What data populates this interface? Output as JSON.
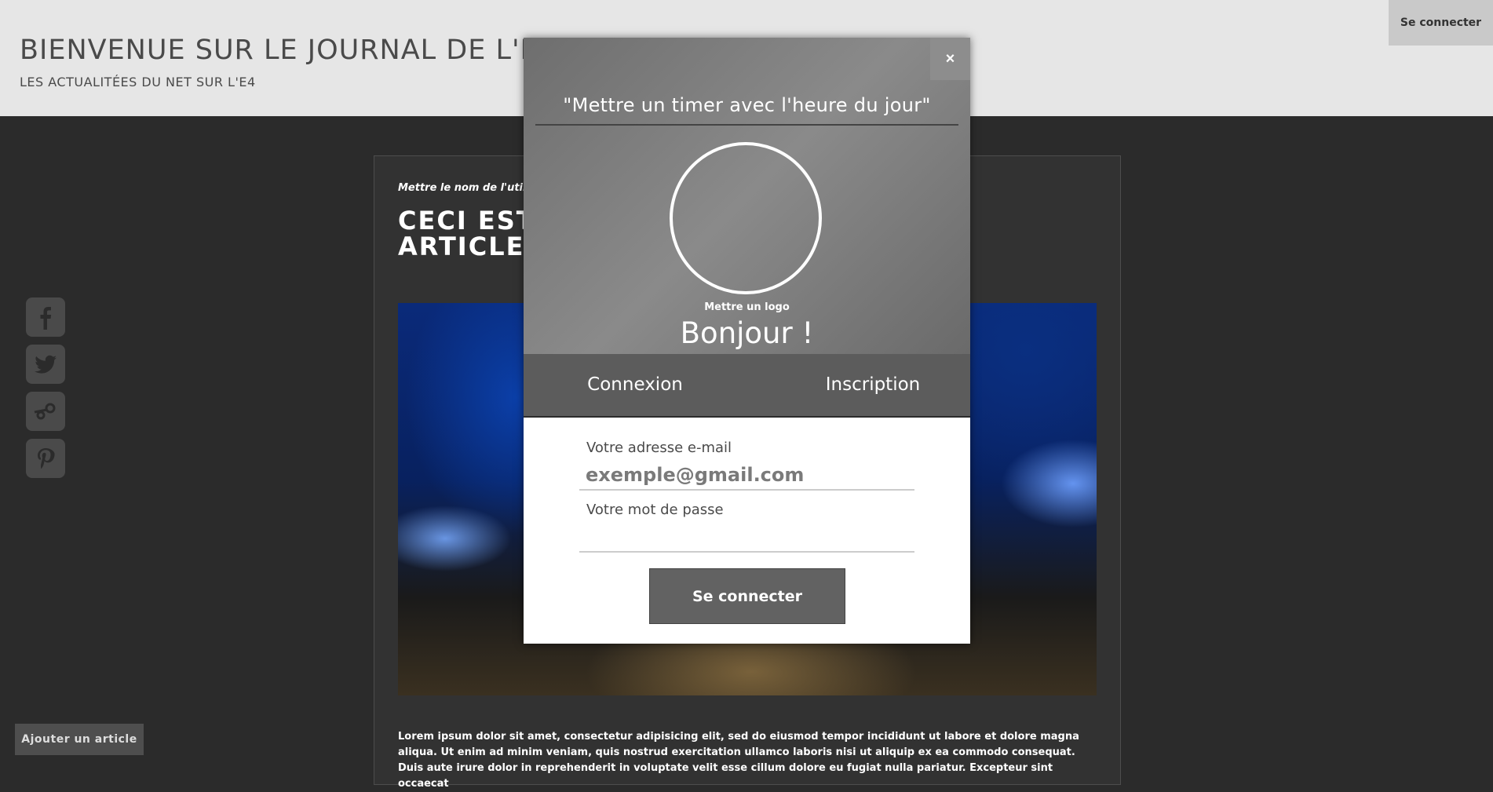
{
  "header": {
    "title": "BIENVENUE SUR LE JOURNAL DE L'E",
    "subtitle": "LES ACTUALITÉES DU NET SUR L'E4",
    "login_label": "Se connecter"
  },
  "article": {
    "author": "Mettre le nom de l'util",
    "title": "CECI EST ARTICLE",
    "body": "Lorem ipsum dolor sit amet, consectetur adipisicing elit, sed do eiusmod tempor incididunt ut labore et dolore magna aliqua. Ut enim ad minim veniam, quis nostrud exercitation ullamco laboris nisi ut aliquip ex ea commodo consequat. Duis aute irure dolor in reprehenderit in voluptate velit esse cillum dolore eu fugiat nulla pariatur. Excepteur sint occaecat"
  },
  "social": [
    {
      "icon": "facebook-icon"
    },
    {
      "icon": "twitter-icon"
    },
    {
      "icon": "steam-icon"
    },
    {
      "icon": "pinterest-icon"
    }
  ],
  "add_article_label": "Ajouter un article",
  "modal": {
    "close_label": "×",
    "timer_text": "\"Mettre un timer avec l'heure du jour\"",
    "logo_label": "Mettre un logo",
    "greeting": "Bonjour !",
    "tabs": [
      {
        "label": "Connexion"
      },
      {
        "label": "Inscription"
      }
    ],
    "email_label": "Votre adresse e-mail",
    "email_placeholder": "exemple@gmail.com",
    "password_label": "Votre mot de passe",
    "password_placeholder": "",
    "submit_label": "Se connecter"
  },
  "colors": {
    "background": "#2b2b2b",
    "header": "#e6e6e6",
    "modal_top": "#7a7a7a",
    "tabs": "#5c5c5c",
    "button": "#626262"
  }
}
